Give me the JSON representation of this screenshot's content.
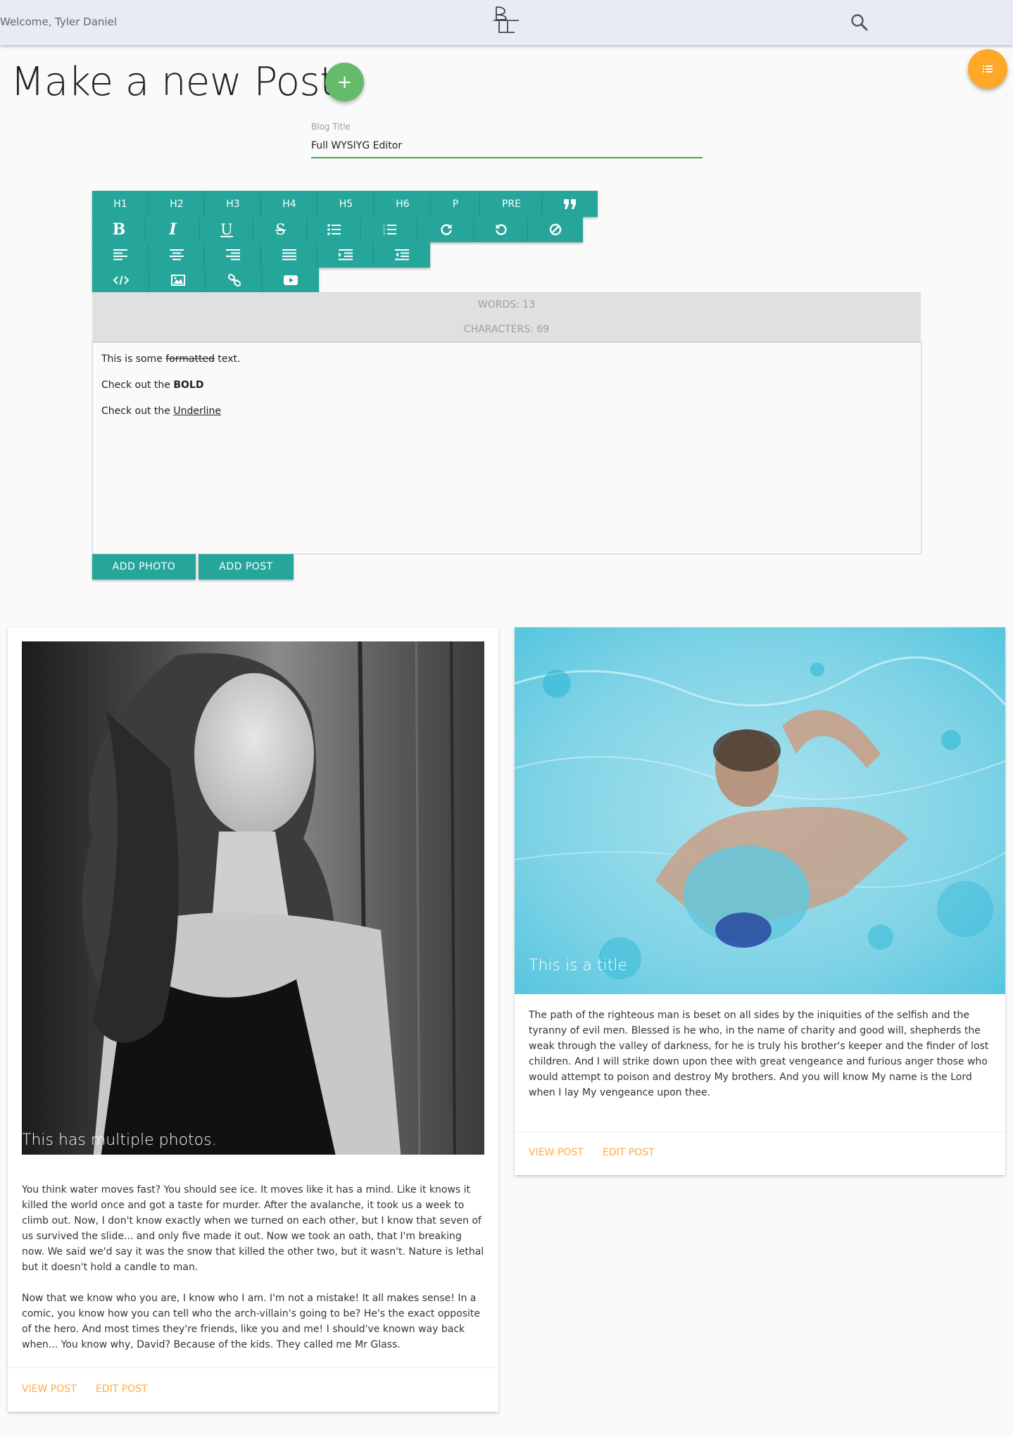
{
  "navbar": {
    "welcome": "Welcome, Tyler Daniel",
    "logo_icon": "blog-logo-icon",
    "search_icon": "search-icon"
  },
  "colors": {
    "navbar": "#e8eaf6",
    "teal": "#26a69a",
    "green_fab": "#66bb6a",
    "orange_fab": "#ffa726",
    "link": "#ffab40"
  },
  "page": {
    "title": "Make a new Post!",
    "add_icon": "+",
    "menu_icon": "list-icon"
  },
  "form": {
    "title_label": "Blog Title",
    "title_value": "Full WYSIYG Editor"
  },
  "toolbar": {
    "headings": [
      "H1",
      "H2",
      "H3",
      "H4",
      "H5",
      "H6",
      "P",
      "PRE"
    ],
    "icons_row1": [
      "quote-icon"
    ],
    "icons_row2": [
      "bold-icon",
      "italic-icon",
      "underline-icon",
      "strikethrough-icon",
      "bullet-list-icon",
      "numbered-list-icon",
      "redo-icon",
      "undo-icon",
      "clear-format-icon"
    ],
    "icons_row3": [
      "align-left-icon",
      "align-center-icon",
      "align-right-icon",
      "justify-icon",
      "indent-icon",
      "outdent-icon"
    ],
    "icons_row4": [
      "code-icon",
      "image-icon",
      "link-icon",
      "video-icon"
    ],
    "bold_glyph": "B",
    "italic_glyph": "I",
    "underline_glyph": "U",
    "strike_glyph": "S"
  },
  "counter": {
    "words": "WORDS: 13",
    "characters": "CHARACTERS: 69"
  },
  "editor": {
    "line1_pre": "This is some ",
    "line1_strike": "formatted",
    "line1_post": " text.",
    "line2_pre": "Check out the ",
    "line2_bold": "BOLD",
    "line3_pre": "Check out the ",
    "line3_under": "Underline"
  },
  "actions": {
    "add_photo": "ADD PHOTO",
    "add_post": "ADD POST"
  },
  "cards": [
    {
      "title": "This has multiple photos.",
      "paragraphs": [
        "You think water moves fast? You should see ice. It moves like it has a mind. Like it knows it killed the world once and got a taste for murder. After the avalanche, it took us a week to climb out. Now, I don't know exactly when we turned on each other, but I know that seven of us survived the slide... and only five made it out. Now we took an oath, that I'm breaking now. We said we'd say it was the snow that killed the other two, but it wasn't. Nature is lethal but it doesn't hold a candle to man.",
        "Now that we know who you are, I know who I am. I'm not a mistake! It all makes sense! In a comic, you know how you can tell who the arch-villain's going to be? He's the exact opposite of the hero. And most times they're friends, like you and me! I should've known way back when... You know why, David? Because of the kids. They called me Mr Glass."
      ],
      "view": "VIEW POST",
      "edit": "EDIT POST"
    },
    {
      "title": "This is a title",
      "paragraphs": [
        "The path of the righteous man is beset on all sides by the iniquities of the selfish and the tyranny of evil men. Blessed is he who, in the name of charity and good will, shepherds the weak through the valley of darkness, for he is truly his brother's keeper and the finder of lost children. And I will strike down upon thee with great vengeance and furious anger those who would attempt to poison and destroy My brothers. And you will know My name is the Lord when I lay My vengeance upon thee."
      ],
      "view": "VIEW POST",
      "edit": "EDIT POST"
    }
  ]
}
